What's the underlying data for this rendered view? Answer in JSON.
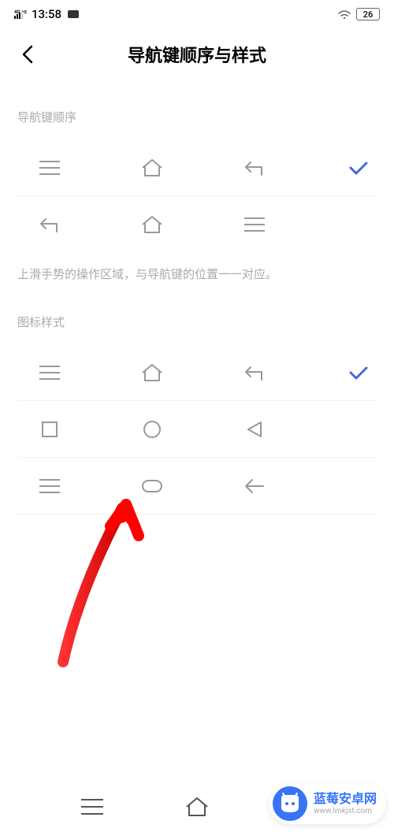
{
  "status_bar": {
    "signal": "4G HD",
    "time": "13:58",
    "battery": "26"
  },
  "header": {
    "title": "导航键顺序与样式"
  },
  "sections": {
    "order": {
      "label": "导航键顺序",
      "help_text": "上滑手势的操作区域，与导航键的位置一一对应。"
    },
    "style": {
      "label": "图标样式"
    }
  },
  "watermark": {
    "name": "蓝莓安卓网",
    "url": "www.lmkjst.com"
  }
}
